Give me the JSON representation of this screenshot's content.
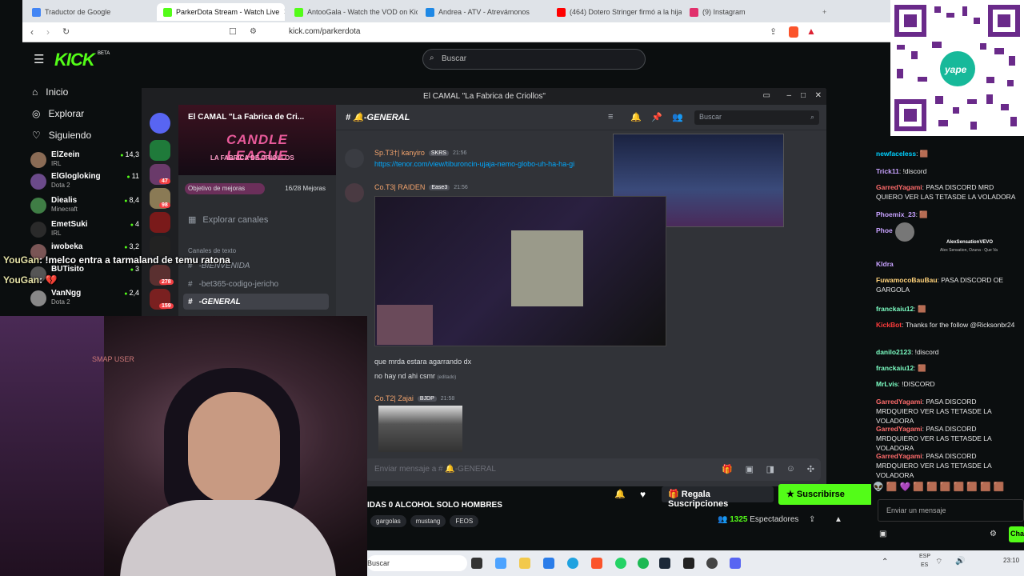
{
  "browser": {
    "tabs": [
      {
        "label": "Traductor de Google",
        "color": "#4285f4",
        "active": false
      },
      {
        "label": "ParkerDota Stream - Watch Live",
        "color": "#53fc18",
        "active": true
      },
      {
        "label": "AntooGala - Watch the VOD on Kick",
        "color": "#53fc18",
        "active": false
      },
      {
        "label": "Andrea - ATV - Atrevámonos",
        "color": "#1e88e5",
        "active": false
      },
      {
        "label": "(464) Dotero Stringer firmó a la hija",
        "color": "#ff0000",
        "active": false
      },
      {
        "label": "(9) Instagram",
        "color": "#e1306c",
        "active": false
      }
    ],
    "url": "kick.com/parkerdota"
  },
  "kick": {
    "logo": "KICK",
    "logo_sup": "BETA",
    "search_placeholder": "Buscar",
    "nav": [
      {
        "icon": "home-icon",
        "label": "Inicio"
      },
      {
        "icon": "compass-icon",
        "label": "Explorar"
      },
      {
        "icon": "heart-icon",
        "label": "Siguiendo"
      }
    ],
    "channels": [
      {
        "name": "ElZeein",
        "game": "IRL",
        "viewers": "14,3",
        "color": "#8a6b55"
      },
      {
        "name": "ElGlogloking",
        "game": "Dota 2",
        "viewers": "11",
        "color": "#6b4a8a"
      },
      {
        "name": "Diealis",
        "game": "Minecraft",
        "viewers": "8,4",
        "color": "#3f7d45"
      },
      {
        "name": "EmetSuki",
        "game": "IRL",
        "viewers": "4",
        "color": "#2a2a2a"
      },
      {
        "name": "iwobeka",
        "game": "",
        "viewers": "3,2",
        "color": "#7a5555"
      },
      {
        "name": "BUTisito",
        "game": "",
        "viewers": "3",
        "color": "#555"
      },
      {
        "name": "VanNgg",
        "game": "Dota 2",
        "viewers": "2,4",
        "color": "#888"
      }
    ]
  },
  "discord": {
    "window_title": "El CAMAL \"La Fabrica de Criollos\"",
    "server_name": "El CAMAL \"La Fabrica de Cri...",
    "banner_title": "CANDLE LEAGUE",
    "banner_sub": "LA FABRICA DE CRIOLLOS",
    "goal_label": "Objetivo de mejoras",
    "goal_value": "16/28 Mejoras",
    "explore_channels": "Explorar canales",
    "category": "Canales de texto",
    "channels": [
      "-BIENVENIDA",
      "-bet365-codigo-jericho",
      "-GENERAL"
    ],
    "active_channel": "-GENERAL",
    "search_placeholder": "Buscar",
    "server_badges": [
      "47",
      "98",
      "278",
      "159"
    ],
    "messages": [
      {
        "author": "Sp.T3†| kanyiro",
        "tag": "SKRS",
        "time": "21:56",
        "text": "https://tenor.com/view/tiburoncin-ujaja-nemo-globo-uh-ha-ha-gi",
        "link": true
      },
      {
        "author": "Co.T3| RAIDEN",
        "tag": "Ease3",
        "time": "21:56",
        "text": "",
        "link": false
      },
      {
        "author": "",
        "tag": "",
        "time": "",
        "text": "que mrda estara agarrando dx",
        "link": false
      },
      {
        "author": "",
        "tag": "",
        "time": "",
        "text": "no hay nd ahi csmr",
        "edited": "(editado)",
        "link": false
      },
      {
        "author": "Co.T2| Zajai",
        "tag": "BJDP",
        "time": "21:58",
        "text": "",
        "link": false
      }
    ],
    "composer_placeholder": "Enviar mensaje a # 🔔-GENERAL"
  },
  "overlay": [
    {
      "user": "YouGan",
      "text": ": !melco entra a tarmaland de temu ratona"
    },
    {
      "user": "YouGan",
      "text": ": 💔"
    }
  ],
  "webcam": {
    "label": "SMAP USER"
  },
  "right_chat": {
    "featured": {
      "name": "AlexSensationVEVO",
      "sub": "Alex Sensation, Ozuna - Que Va"
    },
    "messages": [
      {
        "user": "newfaceless",
        "color": "#00d0ff",
        "text": ": 🟫"
      },
      {
        "user": "Trick11",
        "color": "#c8a2ff",
        "text": ": !discord"
      },
      {
        "user": "GarredYagami",
        "color": "#ff6b6b",
        "text": ": PASA DISCORD MRD QUIERO VER LAS TETASDE LA VOLADORA"
      },
      {
        "user": "Phoemix_23",
        "color": "#c8a2ff",
        "text": ": 🟫"
      },
      {
        "user": "Phoe",
        "color": "#c8a2ff",
        "text": ""
      },
      {
        "user": "Kldra",
        "color": "#c8a2ff",
        "text": ""
      },
      {
        "user": "FuwamocoBauBau",
        "color": "#ffd27a",
        "text": ": PASA DISCORD OE GARGOLA"
      },
      {
        "user": "franckaiu12",
        "color": "#7cffc4",
        "text": ": 🟫"
      },
      {
        "user": "KickBot",
        "color": "#ff3b3b",
        "text": ": Thanks for the follow @Ricksonbr24"
      },
      {
        "user": "danilo2123",
        "color": "#7cffc4",
        "text": ": !discord"
      },
      {
        "user": "franckaiu12",
        "color": "#7cffc4",
        "text": ": 🟫"
      },
      {
        "user": "MrLvis",
        "color": "#7cffc4",
        "text": ": !DISCORD"
      },
      {
        "user": "GarredYagami",
        "color": "#ff6b6b",
        "text": ": PASA DISCORD MRDQUIERO VER LAS TETASDE LA VOLADORA"
      },
      {
        "user": "GarredYagami",
        "color": "#ff6b6b",
        "text": ": PASA DISCORD MRDQUIERO VER LAS TETASDE LA VOLADORA"
      },
      {
        "user": "GarredYagami",
        "color": "#ff6b6b",
        "text": ": PASA DISCORD MRDQUIERO VER LAS TETASDE LA VOLADORA"
      }
    ],
    "input_placeholder": "Enviar un mensaje",
    "chat_button": "Cha"
  },
  "stream": {
    "title": "IDAS 0 ALCOHOL SOLO HOMBRES",
    "tags": [
      "gargolas",
      "mustang",
      "FEOS"
    ],
    "gift_label": "Regala Suscripciones",
    "subscribe_label": "Suscribirse",
    "viewers": "1325",
    "viewers_label": "Espectadores"
  },
  "taskbar": {
    "search_placeholder": "Buscar",
    "lang": "ESP",
    "lang2": "ES",
    "time": "23:10"
  },
  "qr": {
    "brand": "yape"
  }
}
